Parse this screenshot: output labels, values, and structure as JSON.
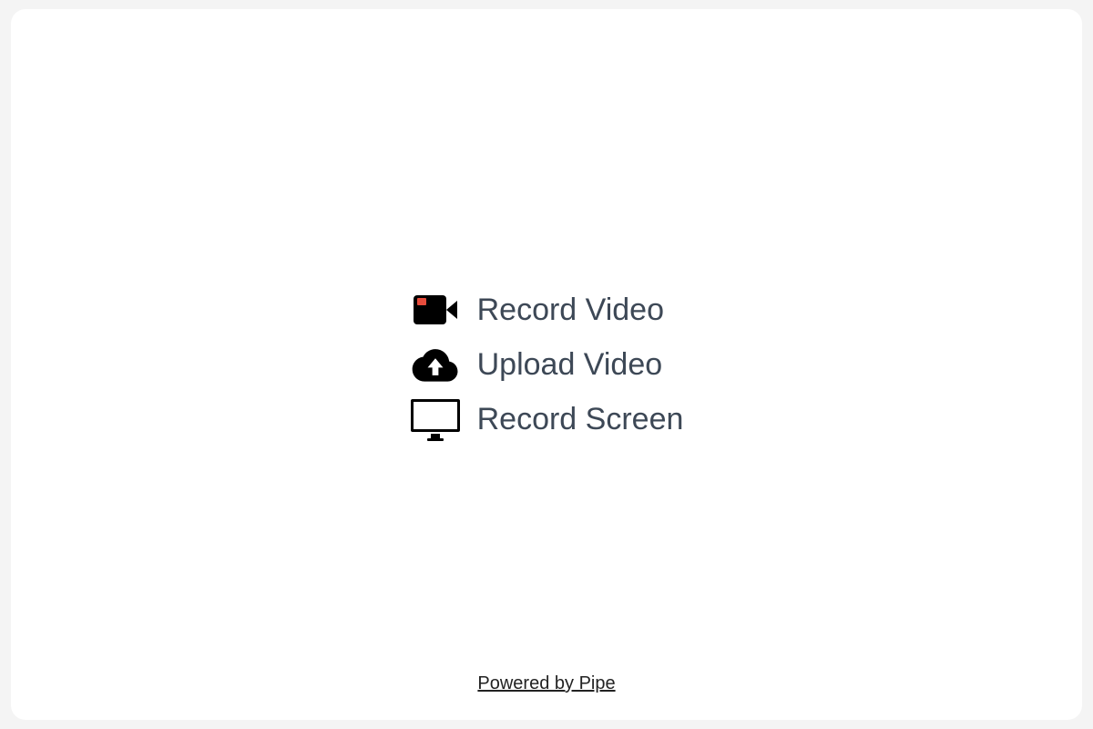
{
  "options": {
    "record_video": {
      "label": "Record Video",
      "icon": "video-camera-icon"
    },
    "upload_video": {
      "label": "Upload Video",
      "icon": "cloud-upload-icon"
    },
    "record_screen": {
      "label": "Record Screen",
      "icon": "monitor-icon"
    }
  },
  "footer": {
    "powered_by": "Powered by Pipe"
  },
  "colors": {
    "text": "#3d4856",
    "icon_black": "#000000",
    "record_dot": "#e74c3c",
    "panel_bg": "#ffffff",
    "page_bg": "#f4f4f4"
  }
}
